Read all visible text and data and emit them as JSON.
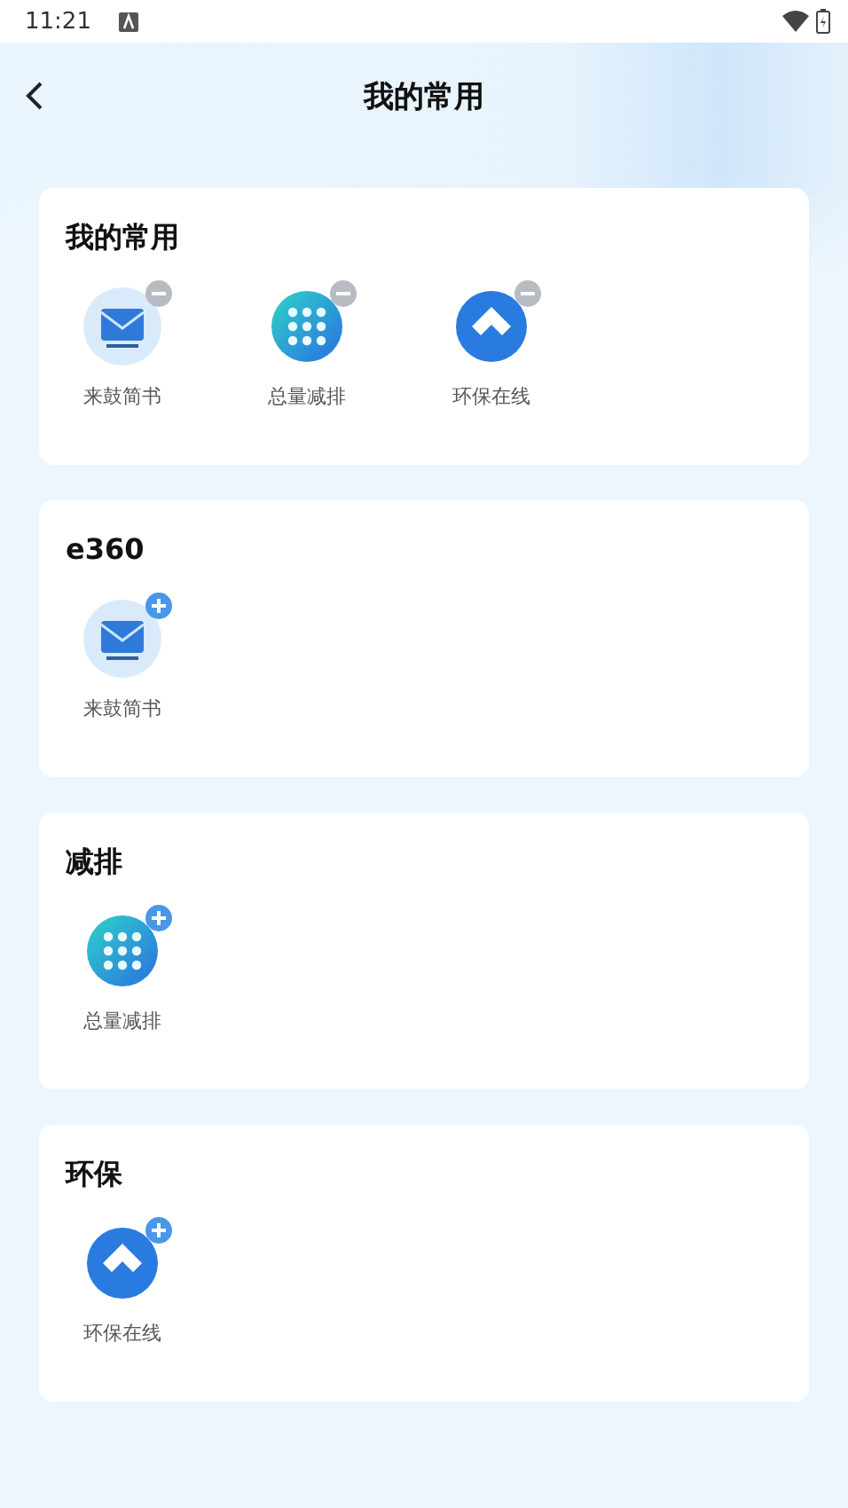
{
  "status_bar": {
    "time": "11:21"
  },
  "header": {
    "title": "我的常用"
  },
  "sections": [
    {
      "title": "我的常用",
      "apps": [
        {
          "label": "来鼓简书",
          "kind": "mail",
          "added": true
        },
        {
          "label": "总量减排",
          "kind": "grid",
          "added": true
        },
        {
          "label": "环保在线",
          "kind": "diamond",
          "added": true
        }
      ]
    },
    {
      "title": "e360",
      "apps": [
        {
          "label": "来鼓简书",
          "kind": "mail",
          "added": false
        }
      ]
    },
    {
      "title": "减排",
      "apps": [
        {
          "label": "总量减排",
          "kind": "grid",
          "added": false
        }
      ]
    },
    {
      "title": "环保",
      "apps": [
        {
          "label": "环保在线",
          "kind": "diamond",
          "added": false
        }
      ]
    }
  ]
}
